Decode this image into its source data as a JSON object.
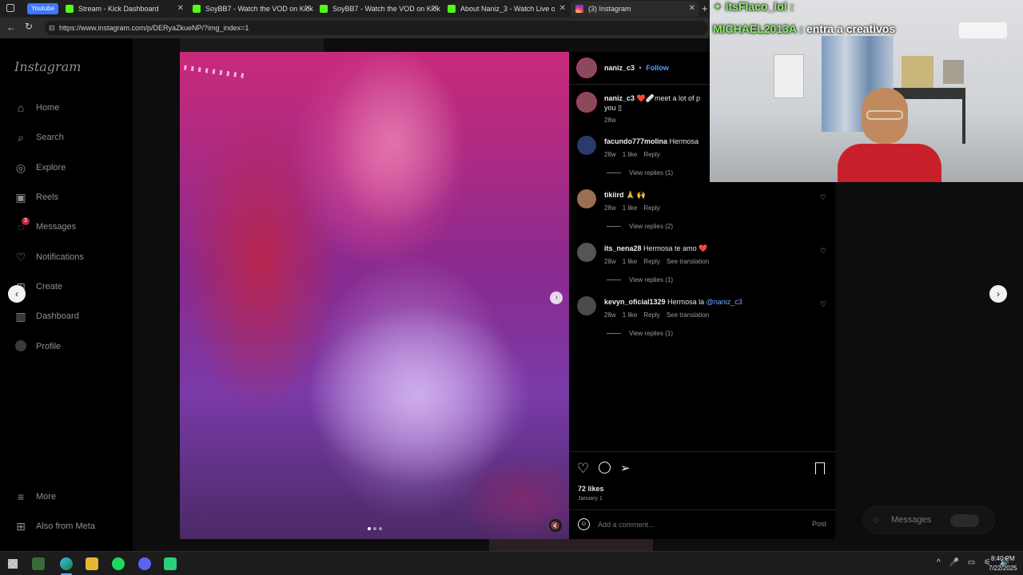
{
  "browser": {
    "tabs": [
      {
        "label": "Stream - Kick Dashboard",
        "badge": "Youtube"
      },
      {
        "label": "SoyBB7 - Watch the VOD on Kick"
      },
      {
        "label": "SoyBB7 - Watch the VOD on Kick"
      },
      {
        "label": "About Naniz_3 - Watch Live on Ki"
      },
      {
        "label": "(3) Instagram"
      }
    ],
    "url": "https://www.instagram.com/p/DERyaZkueNP/?img_index=1"
  },
  "sidebar": {
    "logo": "Instagram",
    "items": [
      {
        "label": "Home",
        "icon": "home-icon"
      },
      {
        "label": "Search",
        "icon": "search-icon"
      },
      {
        "label": "Explore",
        "icon": "explore-icon"
      },
      {
        "label": "Reels",
        "icon": "reels-icon"
      },
      {
        "label": "Messages",
        "icon": "messages-icon",
        "badge": "3"
      },
      {
        "label": "Notifications",
        "icon": "heart-icon"
      },
      {
        "label": "Create",
        "icon": "create-icon"
      },
      {
        "label": "Dashboard",
        "icon": "dashboard-icon"
      },
      {
        "label": "Profile",
        "icon": "profile-icon"
      }
    ],
    "more": "More",
    "also_from_meta": "Also from Meta"
  },
  "post": {
    "author": "naniz_c3",
    "separator": "•",
    "follow": "Follow",
    "caption_user": "naniz_c3",
    "caption_text": "❤️🩹meet a lot of p",
    "caption_text2": "you ▯",
    "caption_age": "28w",
    "likes": "72 likes",
    "date": "January 1",
    "add_comment_placeholder": "Add a comment...",
    "post_button": "Post"
  },
  "comments": [
    {
      "user": "facundo777molina",
      "text": "Hermosa",
      "age": "28w",
      "likes": "1 like",
      "reply": "Reply",
      "translate": "",
      "view_replies": "View replies (1)"
    },
    {
      "user": "tikiird",
      "text": "🙏 🙌",
      "age": "28w",
      "likes": "1 like",
      "reply": "Reply",
      "translate": "",
      "view_replies": "View replies (2)"
    },
    {
      "user": "its_nena28",
      "text": "Hermosa te amo ❤️",
      "age": "28w",
      "likes": "1 like",
      "reply": "Reply",
      "translate": "See translation",
      "view_replies": "View replies (1)"
    },
    {
      "user": "kevyn_oficial1329",
      "text": "Hermosa la",
      "mention": "@naniz_c3",
      "age": "28w",
      "likes": "1 like",
      "reply": "Reply",
      "translate": "See translation",
      "view_replies": "View replies (1)"
    }
  ],
  "overlay": {
    "chat_user1": "itsFlaco_lol :",
    "chat_user2": "MICHAEL2013A :",
    "chat_msg2": "entra a creativos"
  },
  "messages_pill": "Messages",
  "taskbar": {
    "time": "8:40 PM",
    "date": "7/22/2025"
  },
  "carousel": {
    "current": 1,
    "total": 3
  }
}
